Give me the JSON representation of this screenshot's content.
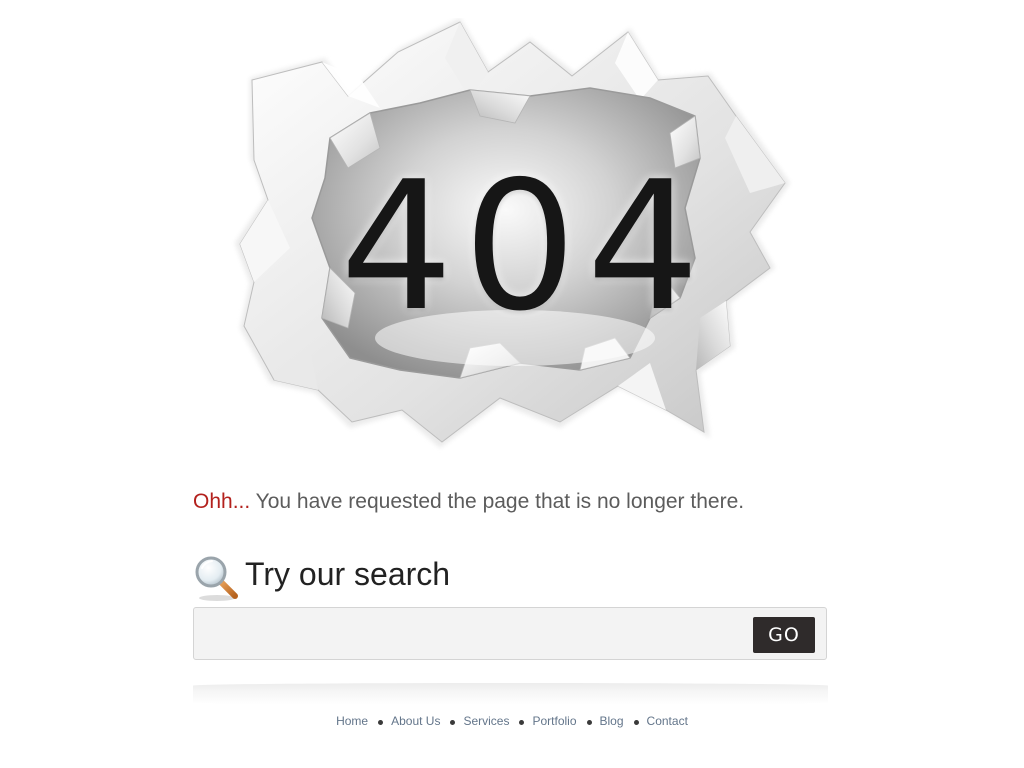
{
  "hero": {
    "error_code": "404"
  },
  "message": {
    "accent": "Ohh...",
    "text": " You have requested the page that is no longer there."
  },
  "search": {
    "heading": "Try our search",
    "placeholder": "",
    "value": "",
    "button_label": "GO",
    "icon": "magnifier-icon"
  },
  "footer": {
    "links": [
      {
        "label": "Home"
      },
      {
        "label": "About Us"
      },
      {
        "label": "Services"
      },
      {
        "label": "Portfolio"
      },
      {
        "label": "Blog"
      },
      {
        "label": "Contact"
      }
    ]
  },
  "colors": {
    "accent": "#b3211d",
    "text": "#5c5c5c",
    "heading": "#222222",
    "button_bg": "#2f2b2b",
    "link": "#63758a",
    "search_bg": "#f3f3f3"
  }
}
